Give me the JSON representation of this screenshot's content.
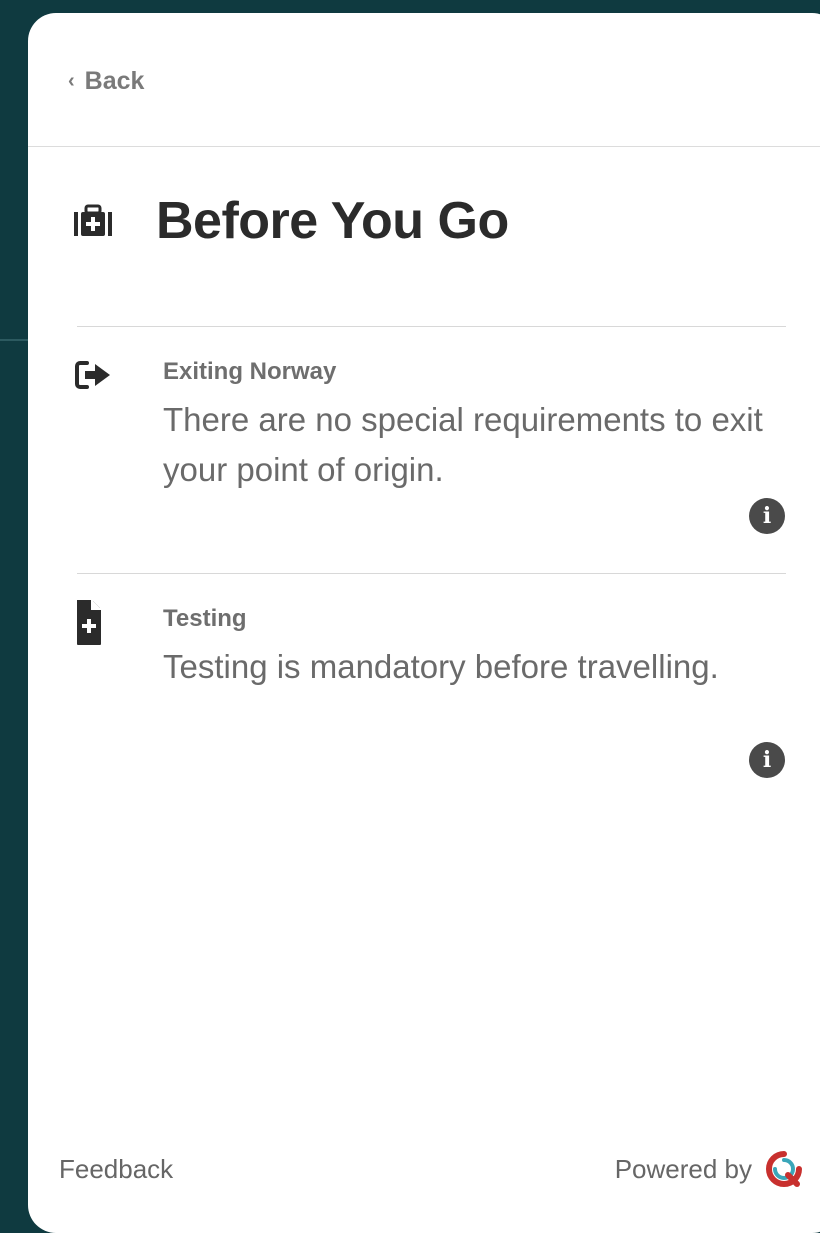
{
  "header": {
    "back_label": "Back"
  },
  "page": {
    "title": "Before You Go",
    "title_icon": "medkit-icon"
  },
  "requirements": [
    {
      "label": "Exiting Norway",
      "text": "There are no special requirements to exit your point of origin.",
      "icon": "sign-out-icon"
    },
    {
      "label": "Testing",
      "text": "Testing is mandatory before travelling.",
      "icon": "file-medical-icon"
    }
  ],
  "footer": {
    "feedback_label": "Feedback",
    "powered_by_label": "Powered by",
    "brand_icon": "brand-logo-icon"
  },
  "colors": {
    "backdrop": "#0f3a40",
    "card": "#ffffff",
    "title_text": "#2b2b2b",
    "body_text": "#6a6a6a",
    "icon_dark": "#2b2b2b",
    "logo_red": "#c8302e",
    "logo_teal": "#3aa6b9"
  }
}
